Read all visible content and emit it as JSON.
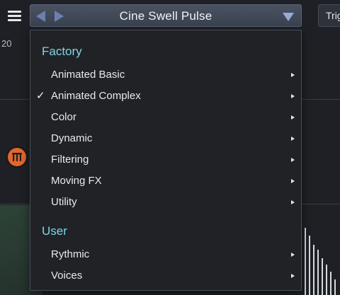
{
  "topbar": {
    "preset_name": "Cine Swell Pulse",
    "trigger_label": "Trig"
  },
  "background": {
    "tick_label": "20"
  },
  "menu": {
    "factory": {
      "heading": "Factory",
      "items": [
        {
          "label": "Animated Basic",
          "checked": false
        },
        {
          "label": "Animated Complex",
          "checked": true
        },
        {
          "label": "Color",
          "checked": false
        },
        {
          "label": "Dynamic",
          "checked": false
        },
        {
          "label": "Filtering",
          "checked": false
        },
        {
          "label": "Moving FX",
          "checked": false
        },
        {
          "label": "Utility",
          "checked": false
        }
      ]
    },
    "user": {
      "heading": "User",
      "items": [
        {
          "label": "Rythmic",
          "checked": false
        },
        {
          "label": "Voices",
          "checked": false
        }
      ]
    },
    "check_glyph": "✓"
  },
  "colors": {
    "accent_heading": "#7fd6e6",
    "knob_orange": "#e2672d"
  }
}
